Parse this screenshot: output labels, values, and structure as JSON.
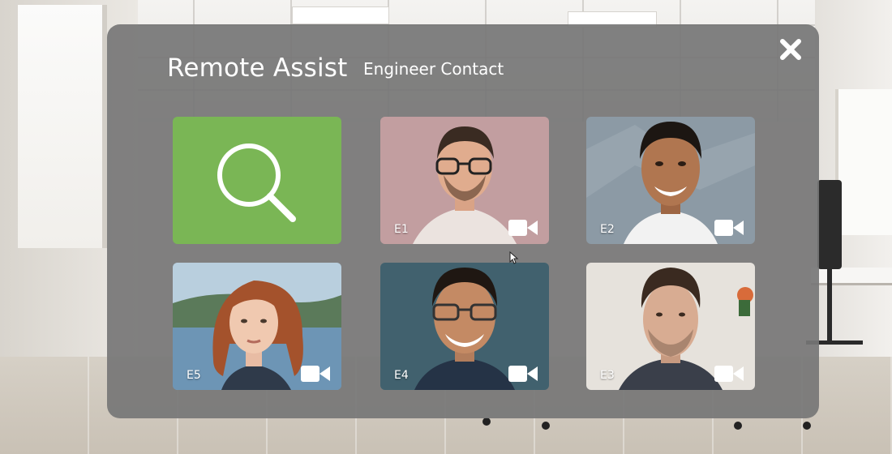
{
  "header": {
    "title": "Remote Assist",
    "subtitle": "Engineer Contact"
  },
  "close_icon": "close-icon",
  "search_tile": {
    "icon": "search-icon",
    "color": "#7ab655"
  },
  "contacts": [
    {
      "label": "E1",
      "icon": "video-camera-icon"
    },
    {
      "label": "E2",
      "icon": "video-camera-icon"
    },
    {
      "label": "E5",
      "icon": "video-camera-icon"
    },
    {
      "label": "E4",
      "icon": "video-camera-icon"
    },
    {
      "label": "E3",
      "icon": "video-camera-icon"
    }
  ],
  "colors": {
    "panel": "#767676",
    "accent_green": "#7ab655",
    "text": "#ffffff"
  }
}
